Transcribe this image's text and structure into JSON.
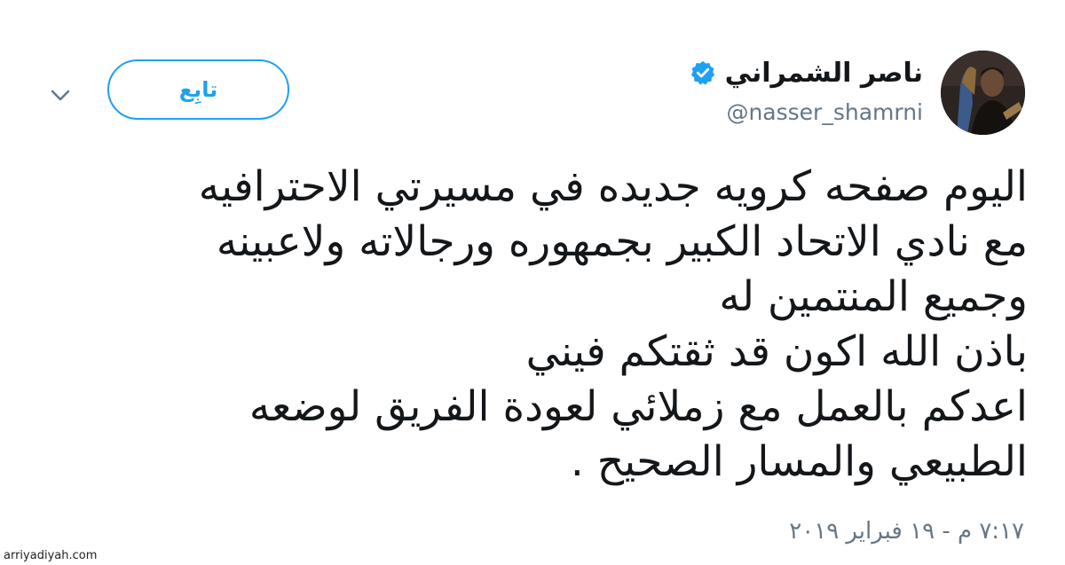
{
  "header": {
    "display_name": "ناصر الشمراني",
    "handle": "@nasser_shamrni",
    "verified": true,
    "follow_label": "تابِع",
    "menu_icon": "chevron-down-icon",
    "verified_icon": "verified-badge-icon"
  },
  "tweet": {
    "lines": [
      "اليوم صفحه كرويه جديده في مسيرتي الاحترافيه",
      "مع نادي الاتحاد الكبير بجمهوره ورجالاته ولاعبينه",
      "وجميع المنتمين له",
      "باذن الله اكون قد ثقتكم فيني",
      "اعدكم بالعمل مع زملائي لعودة الفريق لوضعه",
      "الطبيعي والمسار الصحيح ."
    ],
    "timestamp": "٧:١٧ م - ١٩ فبراير ٢٠١٩"
  },
  "watermark": "arriyadiyah.com",
  "colors": {
    "accent": "#1da1f2",
    "text": "#14171a",
    "secondary": "#657786"
  }
}
